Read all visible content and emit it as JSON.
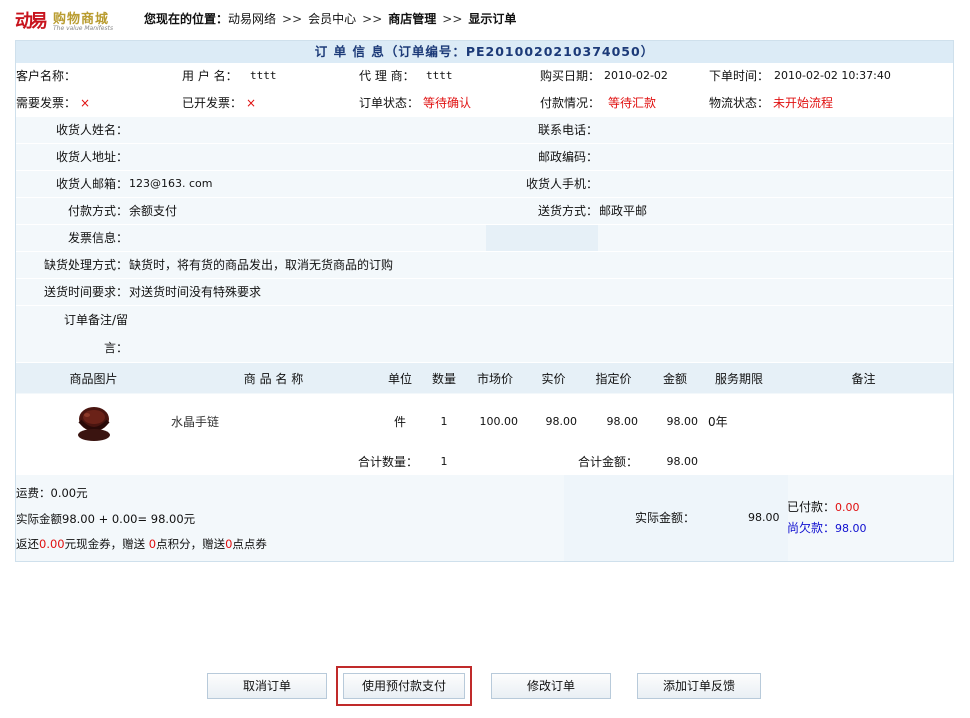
{
  "header": {
    "logo_mark": "动易",
    "logo_text": "购物商城",
    "logo_sub": "The value Manifests",
    "location_label": "您现在的位置：",
    "crumbs": [
      "动易网络",
      "会员中心",
      "商店管理",
      "显示订单"
    ],
    "sep": ">>"
  },
  "order": {
    "title": "订 单 信 息（订单编号：PE2010020210374050）",
    "row1": {
      "customer_label": "客户名称：",
      "customer_value": "",
      "user_label": "用 户 名：",
      "user_value": "tttt",
      "agent_label": "代 理 商：",
      "agent_value": "tttt",
      "buy_date_label": "购买日期：",
      "buy_date_value": "2010-02-02",
      "order_time_label": "下单时间：",
      "order_time_value": "2010-02-02 10:37:40"
    },
    "row2": {
      "need_invoice_label": "需要发票：",
      "need_invoice_value": "×",
      "invoiced_label": "已开发票：",
      "invoiced_value": "×",
      "status_label": "订单状态：",
      "status_value": "等待确认",
      "payment_label": "付款情况：",
      "payment_value": "等待汇款",
      "logistics_label": "物流状态：",
      "logistics_value": "未开始流程"
    },
    "receiver": {
      "name_label": "收货人姓名：",
      "name_value": "",
      "phone_label": "联系电话：",
      "phone_value": "",
      "address_label": "收货人地址：",
      "address_value": "",
      "zip_label": "邮政编码：",
      "zip_value": "",
      "email_label": "收货人邮箱：",
      "email_value": "123@163. com",
      "mobile_label": "收货人手机：",
      "mobile_value": "",
      "pay_method_label": "付款方式：",
      "pay_method_value": "余额支付",
      "ship_method_label": "送货方式：",
      "ship_method_value": "邮政平邮",
      "invoice_info_label": "发票信息：",
      "invoice_info_value": "",
      "shortage_label": "缺货处理方式：",
      "shortage_value": "缺货时，将有货的商品发出，取消无货商品的订购",
      "delivery_time_label": "送货时间要求：",
      "delivery_time_value": "对送货时间没有特殊要求",
      "remark_label_line1": "订单备注/留",
      "remark_label_line2": "言：",
      "remark_value": ""
    },
    "goods": {
      "columns": [
        "商品图片",
        "商 品 名 称",
        "单位",
        "数量",
        "市场价",
        "实价",
        "指定价",
        "金额",
        "服务期限",
        "备注"
      ],
      "items": [
        {
          "name": "水晶手链",
          "unit": "件",
          "qty": "1",
          "market": "100.00",
          "real": "98.00",
          "assigned": "98.00",
          "amount": "98.00",
          "service": "0年",
          "note": ""
        }
      ],
      "total_qty_label": "合计数量：",
      "total_qty": "1",
      "total_amount_label": "合计金额：",
      "total_amount": "98.00"
    },
    "footer": {
      "freight": "运费：0.00元",
      "actual_prefix": "实际金额98.00 + 0.00= 98.00元",
      "rebate_a": "返还",
      "rebate_num1": "0.00",
      "rebate_b": "元现金券，赠送 ",
      "rebate_num2": "0",
      "rebate_c": "点积分，赠送",
      "rebate_num3": "0",
      "rebate_d": "点点券",
      "actual_label": "实际金额：",
      "actual_value": "98.00",
      "paid_label": "已付款：",
      "paid_value": "0.00",
      "owed_label": "尚欠款：",
      "owed_value": "98.00"
    }
  },
  "buttons": {
    "cancel": "取消订单",
    "prepay": "使用预付款支付",
    "modify": "修改订单",
    "feedback": "添加订单反馈"
  },
  "colors": {
    "accent": "#1c3a78",
    "alert": "#e01010",
    "highlight": "#c02a2a"
  }
}
